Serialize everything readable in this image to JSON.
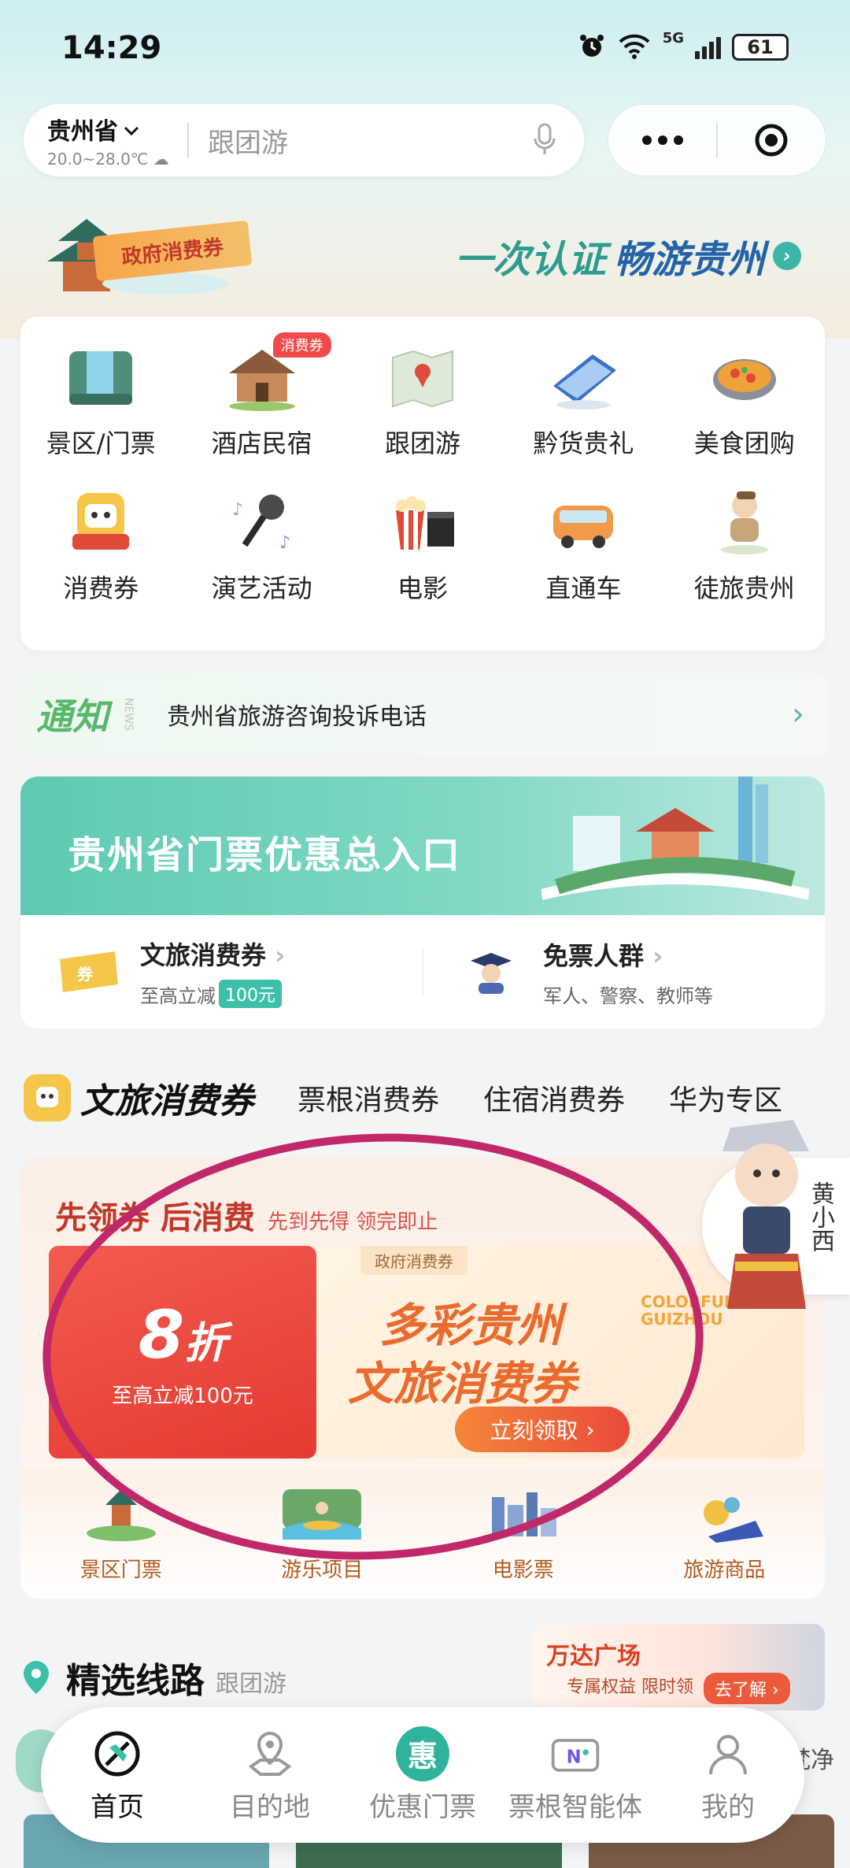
{
  "status": {
    "time": "14:29",
    "network": "5G",
    "battery": "61"
  },
  "search": {
    "location": "贵州省",
    "temp": "20.0~28.0℃",
    "placeholder": "跟团游"
  },
  "banner": {
    "tag": "政府消费券",
    "slogan_a": "一次认证",
    "slogan_b": "畅游贵州"
  },
  "grid": {
    "items": [
      {
        "label": "景区/门票",
        "icon": "waterfall-icon"
      },
      {
        "label": "酒店民宿",
        "icon": "house-icon",
        "badge": "消费券"
      },
      {
        "label": "跟团游",
        "icon": "map-icon"
      },
      {
        "label": "黔货贵礼",
        "icon": "gift-icon"
      },
      {
        "label": "美食团购",
        "icon": "food-icon"
      },
      {
        "label": "消费券",
        "icon": "coupon-icon"
      },
      {
        "label": "演艺活动",
        "icon": "microphone-icon"
      },
      {
        "label": "电影",
        "icon": "popcorn-icon"
      },
      {
        "label": "直通车",
        "icon": "bus-icon"
      },
      {
        "label": "徒旅贵州",
        "icon": "hiker-icon"
      }
    ]
  },
  "notice": {
    "tag": "通知",
    "sub": "NEWS",
    "text": "贵州省旅游咨询投诉电话"
  },
  "tickets": {
    "title": "贵州省门票优惠总入口",
    "voucher": {
      "title": "文旅消费券",
      "desc": "至高立减",
      "amount": "100元"
    },
    "free": {
      "title": "免票人群",
      "desc": "军人、警察、教师等"
    }
  },
  "tabs": {
    "active": "文旅消费券",
    "items": [
      "票根消费券",
      "住宿消费券",
      "华为专区"
    ]
  },
  "voucher": {
    "head1": "先领券 后消费",
    "head2": "先到先得 领完即止",
    "discount": "8",
    "discount_unit": "折",
    "limit": "至高立减100元",
    "gov_tag": "政府消费券",
    "title1": "多彩贵州",
    "title2": "文旅消费券",
    "en1": "COLORFUL",
    "en2": "GUIZHOU",
    "button": "立刻领取",
    "categories": [
      "景区门票",
      "游乐项目",
      "电影票",
      "旅游商品"
    ]
  },
  "mascot": {
    "name": "黄小西"
  },
  "routes": {
    "title": "精选线路",
    "sub": "跟团游"
  },
  "ad": {
    "title": "万达广场",
    "desc": "专属权益 限时领",
    "button": "去了解"
  },
  "behind": {
    "right_text": "梵净"
  },
  "tabbar": {
    "items": [
      {
        "label": "首页",
        "icon": "home-icon",
        "active": true
      },
      {
        "label": "目的地",
        "icon": "destination-icon"
      },
      {
        "label": "优惠门票",
        "icon": "hui-icon",
        "glyph": "惠"
      },
      {
        "label": "票根智能体",
        "icon": "ticket-ai-icon"
      },
      {
        "label": "我的",
        "icon": "profile-icon"
      }
    ]
  },
  "colors": {
    "accent": "#2fb39a",
    "voucher_red": "#e43a32",
    "annotation": "#c1286a"
  }
}
